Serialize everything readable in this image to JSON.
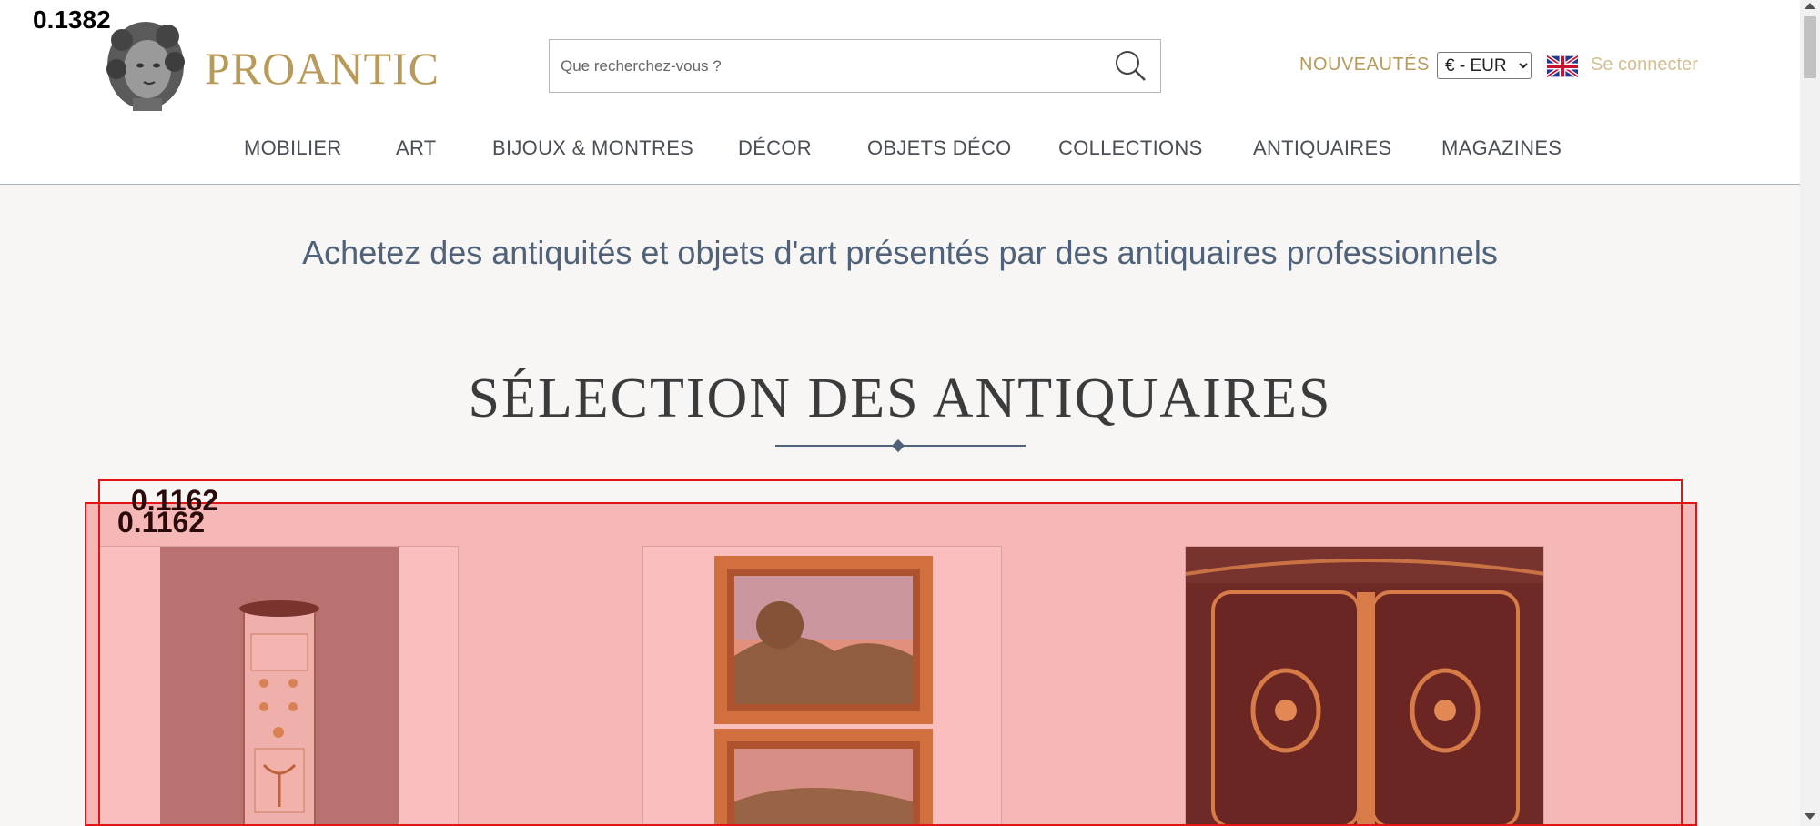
{
  "header": {
    "logo_text": "PROANTIC",
    "search": {
      "placeholder": "Que recherchez-vous ?"
    },
    "nouveautes": "NOUVEAUTÉS",
    "currency": {
      "selected": "€ - EUR"
    },
    "login": "Se connecter"
  },
  "nav": {
    "items": [
      {
        "label": "MOBILIER"
      },
      {
        "label": "ART"
      },
      {
        "label": "BIJOUX & MONTRES"
      },
      {
        "label": "DÉCOR"
      },
      {
        "label": "OBJETS DÉCO"
      },
      {
        "label": "COLLECTIONS"
      },
      {
        "label": "ANTIQUAIRES"
      },
      {
        "label": "MAGAZINES"
      }
    ]
  },
  "main": {
    "tagline": "Achetez des antiquités et objets d'art présentés par des antiquaires professionnels",
    "section_title": "SÉLECTION DES ANTIQUAIRES"
  },
  "overlay": {
    "corner_label": "0.1382",
    "box_label_1": "0.1162",
    "box_label_2": "0.1162"
  },
  "colors": {
    "brand_gold": "#b89a5a",
    "title_blue": "#4f6279",
    "overlay_red": "#e01515"
  }
}
